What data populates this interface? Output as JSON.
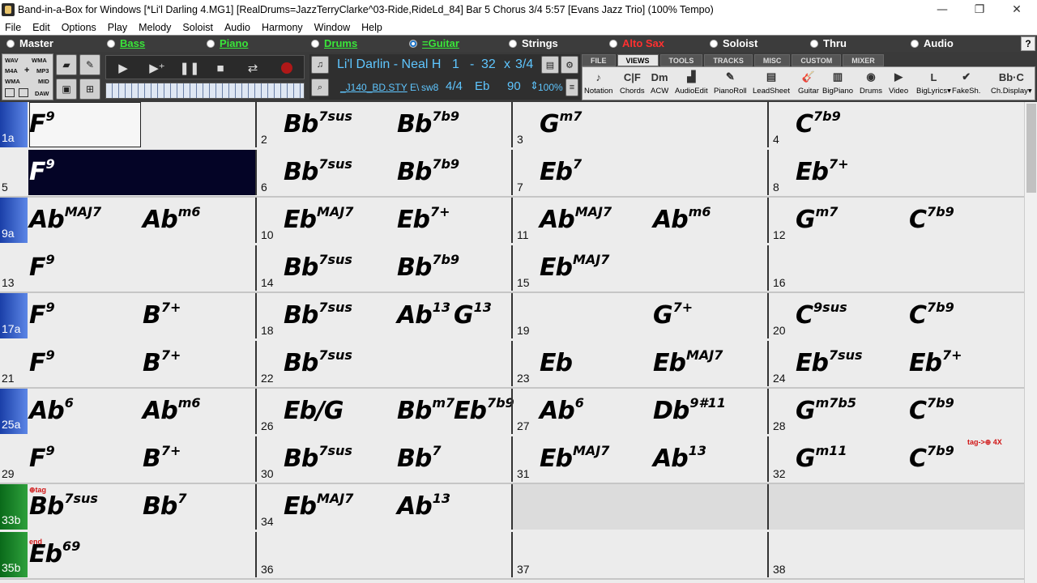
{
  "window": {
    "title": "Band-in-a-Box for Windows  [*Li'l Darling 4.MG1] [RealDrums=JazzTerryClarke^03-Ride,RideLd_84] Bar 5 Chorus 3/4   5:57  [Evans Jazz Trio] (100% Tempo)",
    "minimize": "—",
    "maximize": "❐",
    "close": "✕"
  },
  "menu": [
    "File",
    "Edit",
    "Options",
    "Play",
    "Melody",
    "Soloist",
    "Audio",
    "Harmony",
    "Window",
    "Help"
  ],
  "tracks": [
    {
      "label": "Master",
      "color": "#ffffff",
      "selected": false
    },
    {
      "label": "Bass",
      "color": "#39e639",
      "selected": false
    },
    {
      "label": "Piano",
      "color": "#39e639",
      "selected": false
    },
    {
      "label": "Drums",
      "color": "#39e639",
      "selected": false
    },
    {
      "label": "=Guitar",
      "color": "#39e639",
      "selected": true
    },
    {
      "label": "Strings",
      "color": "#ffffff",
      "selected": false
    },
    {
      "label": "Alto Sax",
      "color": "#ff3030",
      "selected": false
    },
    {
      "label": "Soloist",
      "color": "#ffffff",
      "selected": false
    },
    {
      "label": "Thru",
      "color": "#ffffff",
      "selected": false
    },
    {
      "label": "Audio",
      "color": "#ffffff",
      "selected": false
    }
  ],
  "help_label": "?",
  "formats": {
    "wav": "WAV",
    "wma1": "WMA",
    "m4a": "M4A",
    "plus": "+",
    "mp3": "MP3",
    "wma2": "WMA",
    "mid": "MID",
    "daw": "DAW"
  },
  "song": {
    "title": "Li'l Darlin - Neal H",
    "start": "1",
    "dash": "-",
    "end": "32",
    "times": "x",
    "choruses": "3/4",
    "style": "_J140_BD.STY",
    "style_suffix": "E\\",
    "feel": "sw8",
    "time_sig": "4/4",
    "key": "Eb",
    "tempo": "90",
    "tempo_pct": "100%"
  },
  "tabs": [
    "FILE",
    "VIEWS",
    "TOOLS",
    "TRACKS",
    "MISC",
    "CUSTOM",
    "MIXER"
  ],
  "active_tab": "VIEWS",
  "views": [
    {
      "label": "Notation",
      "icon": "♪",
      "icon_name": "notation-icon"
    },
    {
      "label": "Chords",
      "icon": "C|F",
      "icon_name": "chords-icon"
    },
    {
      "label": "ACW",
      "icon": "Dm",
      "icon_name": "acw-icon"
    },
    {
      "label": "AudioEdit",
      "icon": "▟",
      "icon_name": "audioedit-icon"
    },
    {
      "label": "PianoRoll",
      "icon": "✎",
      "icon_name": "pianoroll-icon"
    },
    {
      "label": "LeadSheet",
      "icon": "▤",
      "icon_name": "leadsheet-icon"
    },
    {
      "label": "Guitar",
      "icon": "🎸",
      "icon_name": "guitar-icon"
    },
    {
      "label": "BigPiano",
      "icon": "▥",
      "icon_name": "bigpiano-icon"
    },
    {
      "label": "Drums",
      "icon": "◉",
      "icon_name": "drums-icon"
    },
    {
      "label": "Video",
      "icon": "▶",
      "icon_name": "video-icon"
    },
    {
      "label": "BigLyrics▾",
      "icon": "L",
      "icon_name": "biglyrics-icon"
    },
    {
      "label": "FakeSh.",
      "icon": "✔",
      "icon_name": "fakesheet-icon"
    },
    {
      "label": "Ch.Display▾",
      "icon": "Bb·C",
      "icon_name": "chorddisplay-icon"
    }
  ],
  "rows": [
    {
      "bars": [
        {
          "num": "1a",
          "marker": "blue",
          "chords": [
            {
              "r": "F",
              "e": "9",
              "pos": 0
            }
          ]
        },
        {
          "num": "2",
          "chords": [
            {
              "r": "Bb",
              "e": "7sus",
              "pos": 0
            },
            {
              "r": "Bb",
              "e": "7b9",
              "pos": 2
            }
          ]
        },
        {
          "num": "3",
          "chords": [
            {
              "r": "G",
              "e": "m7",
              "pos": 0
            }
          ]
        },
        {
          "num": "4",
          "chords": [
            {
              "r": "C",
              "e": "7b9",
              "pos": 0
            }
          ]
        }
      ]
    },
    {
      "bars": [
        {
          "num": "5",
          "current": true,
          "chords": [
            {
              "r": "F",
              "e": "9",
              "pos": 0
            }
          ]
        },
        {
          "num": "6",
          "chords": [
            {
              "r": "Bb",
              "e": "7sus",
              "pos": 0
            },
            {
              "r": "Bb",
              "e": "7b9",
              "pos": 2
            }
          ]
        },
        {
          "num": "7",
          "chords": [
            {
              "r": "Eb",
              "e": "7",
              "pos": 0
            }
          ]
        },
        {
          "num": "8",
          "chords": [
            {
              "r": "Eb",
              "e": "7+",
              "pos": 0
            }
          ]
        }
      ]
    },
    {
      "bars": [
        {
          "num": "9a",
          "marker": "blue",
          "chords": [
            {
              "r": "Ab",
              "e": "MAJ7",
              "pos": 0
            },
            {
              "r": "Ab",
              "e": "m6",
              "pos": 2
            }
          ]
        },
        {
          "num": "10",
          "chords": [
            {
              "r": "Eb",
              "e": "MAJ7",
              "pos": 0
            },
            {
              "r": "Eb",
              "e": "7+",
              "pos": 2
            }
          ]
        },
        {
          "num": "11",
          "chords": [
            {
              "r": "Ab",
              "e": "MAJ7",
              "pos": 0
            },
            {
              "r": "Ab",
              "e": "m6",
              "pos": 2
            }
          ]
        },
        {
          "num": "12",
          "chords": [
            {
              "r": "G",
              "e": "m7",
              "pos": 0
            },
            {
              "r": "C",
              "e": "7b9",
              "pos": 2
            }
          ]
        }
      ]
    },
    {
      "bars": [
        {
          "num": "13",
          "chords": [
            {
              "r": "F",
              "e": "9",
              "pos": 0
            }
          ]
        },
        {
          "num": "14",
          "chords": [
            {
              "r": "Bb",
              "e": "7sus",
              "pos": 0
            },
            {
              "r": "Bb",
              "e": "7b9",
              "pos": 2
            }
          ]
        },
        {
          "num": "15",
          "chords": [
            {
              "r": "Eb",
              "e": "MAJ7",
              "pos": 0
            }
          ]
        },
        {
          "num": "16",
          "chords": []
        }
      ]
    },
    {
      "bars": [
        {
          "num": "17a",
          "marker": "blue",
          "chords": [
            {
              "r": "F",
              "e": "9",
              "pos": 0
            },
            {
              "r": "B",
              "e": "7+",
              "pos": 2
            }
          ]
        },
        {
          "num": "18",
          "chords": [
            {
              "r": "Bb",
              "e": "7sus",
              "pos": 0
            },
            {
              "r": "Ab",
              "e": "13",
              "pos": 2
            },
            {
              "r": "G",
              "e": "13",
              "pos": 3
            }
          ]
        },
        {
          "num": "19",
          "chords": [
            {
              "r": "G",
              "e": "7+",
              "pos": 2
            }
          ]
        },
        {
          "num": "20",
          "chords": [
            {
              "r": "C",
              "e": "9sus",
              "pos": 0
            },
            {
              "r": "C",
              "e": "7b9",
              "pos": 2
            }
          ]
        }
      ]
    },
    {
      "bars": [
        {
          "num": "21",
          "chords": [
            {
              "r": "F",
              "e": "9",
              "pos": 0
            },
            {
              "r": "B",
              "e": "7+",
              "pos": 2
            }
          ]
        },
        {
          "num": "22",
          "chords": [
            {
              "r": "Bb",
              "e": "7sus",
              "pos": 0
            }
          ]
        },
        {
          "num": "23",
          "chords": [
            {
              "r": "Eb",
              "e": "",
              "pos": 0
            },
            {
              "r": "Eb",
              "e": "MAJ7",
              "pos": 2
            }
          ]
        },
        {
          "num": "24",
          "chords": [
            {
              "r": "Eb",
              "e": "7sus",
              "pos": 0
            },
            {
              "r": "Eb",
              "e": "7+",
              "pos": 2
            }
          ]
        }
      ]
    },
    {
      "bars": [
        {
          "num": "25a",
          "marker": "blue",
          "chords": [
            {
              "r": "Ab",
              "e": "6",
              "pos": 0
            },
            {
              "r": "Ab",
              "e": "m6",
              "pos": 2
            }
          ]
        },
        {
          "num": "26",
          "chords": [
            {
              "r": "Eb/G",
              "e": "",
              "pos": 0
            },
            {
              "r": "Bb",
              "e": "m7",
              "pos": 2
            },
            {
              "r": "Eb",
              "e": "7b9",
              "pos": 3
            }
          ]
        },
        {
          "num": "27",
          "chords": [
            {
              "r": "Ab",
              "e": "6",
              "pos": 0
            },
            {
              "r": "Db",
              "e": "9#11",
              "pos": 2
            }
          ]
        },
        {
          "num": "28",
          "chords": [
            {
              "r": "G",
              "e": "m7b5",
              "pos": 0
            },
            {
              "r": "C",
              "e": "7b9",
              "pos": 2
            }
          ]
        }
      ]
    },
    {
      "bars": [
        {
          "num": "29",
          "chords": [
            {
              "r": "F",
              "e": "9",
              "pos": 0
            },
            {
              "r": "B",
              "e": "7+",
              "pos": 2
            }
          ]
        },
        {
          "num": "30",
          "chords": [
            {
              "r": "Bb",
              "e": "7sus",
              "pos": 0
            },
            {
              "r": "Bb",
              "e": "7",
              "pos": 2
            }
          ]
        },
        {
          "num": "31",
          "chords": [
            {
              "r": "Eb",
              "e": "MAJ7",
              "pos": 0
            },
            {
              "r": "Ab",
              "e": "13",
              "pos": 2
            }
          ]
        },
        {
          "num": "32",
          "chords": [
            {
              "r": "G",
              "e": "m11",
              "pos": 0
            },
            {
              "r": "C",
              "e": "7b9",
              "pos": 2
            }
          ]
        }
      ]
    },
    {
      "bars": [
        {
          "num": "33b",
          "marker": "green",
          "chords": [
            {
              "r": "Bb",
              "e": "7sus",
              "pos": 0
            },
            {
              "r": "Bb",
              "e": "7",
              "pos": 2
            }
          ]
        },
        {
          "num": "34",
          "chords": [
            {
              "r": "Eb",
              "e": "MAJ7",
              "pos": 0
            },
            {
              "r": "Ab",
              "e": "13",
              "pos": 2
            }
          ]
        },
        {
          "num": "",
          "empty": true,
          "chords": []
        },
        {
          "num": "",
          "empty": true,
          "chords": []
        }
      ]
    },
    {
      "bars": [
        {
          "num": "35b",
          "marker": "green",
          "chords": [
            {
              "r": "Eb",
              "e": "69",
              "pos": 0
            }
          ]
        },
        {
          "num": "36",
          "chords": []
        },
        {
          "num": "37",
          "chords": []
        },
        {
          "num": "38",
          "chords": []
        }
      ]
    }
  ],
  "annotations": {
    "tag_jump": "tag->⊕ 4X",
    "tag_mark": "⊕tag",
    "end_mark": "end"
  }
}
